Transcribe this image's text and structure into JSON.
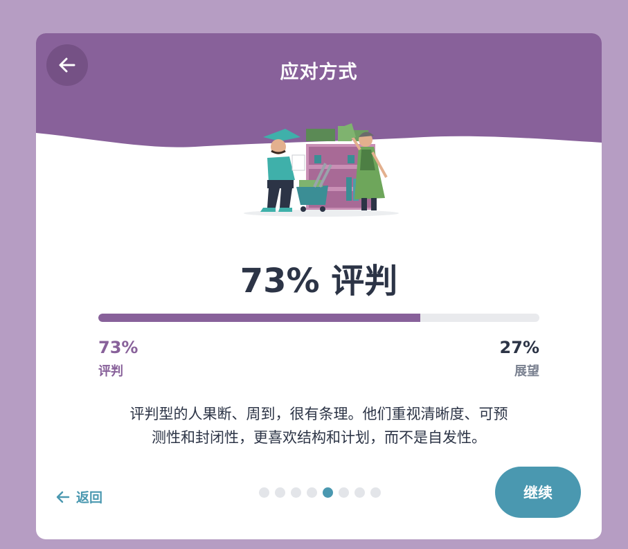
{
  "header": {
    "title": "应对方式",
    "back_icon": "arrow-left-icon"
  },
  "illustration": {
    "name": "shopkeepers-illustration"
  },
  "result": {
    "headline": "73% 评判",
    "progress_fraction": 0.73,
    "left": {
      "percent": "73%",
      "label": "评判"
    },
    "right": {
      "percent": "27%",
      "label": "展望"
    }
  },
  "description": {
    "line1": "评判型的人果断、周到，很有条理。他们重视清晰度、可预",
    "line2": "测性和封闭性，更喜欢结构和计划，而不是自发性。"
  },
  "footer": {
    "back_label": "返回",
    "continue_label": "继续",
    "pagination": {
      "total": 8,
      "active_index": 4
    }
  },
  "colors": {
    "page_bg": "#b69dc3",
    "header_purple": "#88619a",
    "accent_teal": "#4a98b0",
    "text_dark": "#2c3446"
  }
}
